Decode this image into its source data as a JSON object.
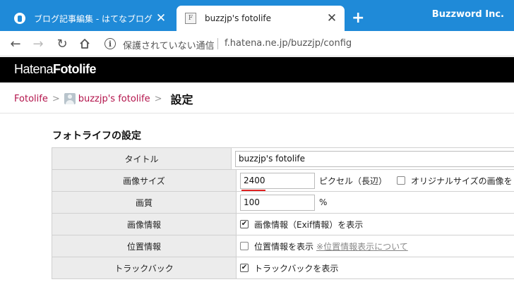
{
  "browser": {
    "tabs": [
      {
        "title": "ブログ記事編集 - はてなブログ",
        "active": false,
        "favicon": "blog-icon"
      },
      {
        "title": "buzzjp's fotolife",
        "active": true,
        "favicon": "F"
      }
    ],
    "brand": "Buzzword Inc.",
    "security_label": "保護されていない通信",
    "url": "f.hatena.ne.jp/buzzjp/config"
  },
  "site": {
    "logo_main": "Hatena",
    "logo_sub": "Fotolife"
  },
  "breadcrumb": {
    "root": "Fotolife",
    "user": "buzzjp's fotolife",
    "current": "設定",
    "separator": ">"
  },
  "settings": {
    "section_title": "フォトライフの設定",
    "rows": {
      "title": {
        "label": "タイトル",
        "value": "buzzjp's fotolife"
      },
      "size": {
        "label": "画像サイズ",
        "value": "2400",
        "unit": "ピクセル（長辺）",
        "original_option": "オリジナルサイズの画像を"
      },
      "quality": {
        "label": "画質",
        "value": "100",
        "unit": "%"
      },
      "image_info": {
        "label": "画像情報",
        "option": "画像情報（Exif情報）を表示",
        "checked": true
      },
      "location": {
        "label": "位置情報",
        "option": "位置情報を表示",
        "link": "※位置情報表示について",
        "checked": false
      },
      "trackback": {
        "label": "トラックバック",
        "option": "トラックバックを表示",
        "checked": true
      }
    }
  },
  "colors": {
    "tabbar": "#1f8ad8",
    "link": "#b3134b",
    "header": "#000000",
    "underline": "#e02020"
  }
}
